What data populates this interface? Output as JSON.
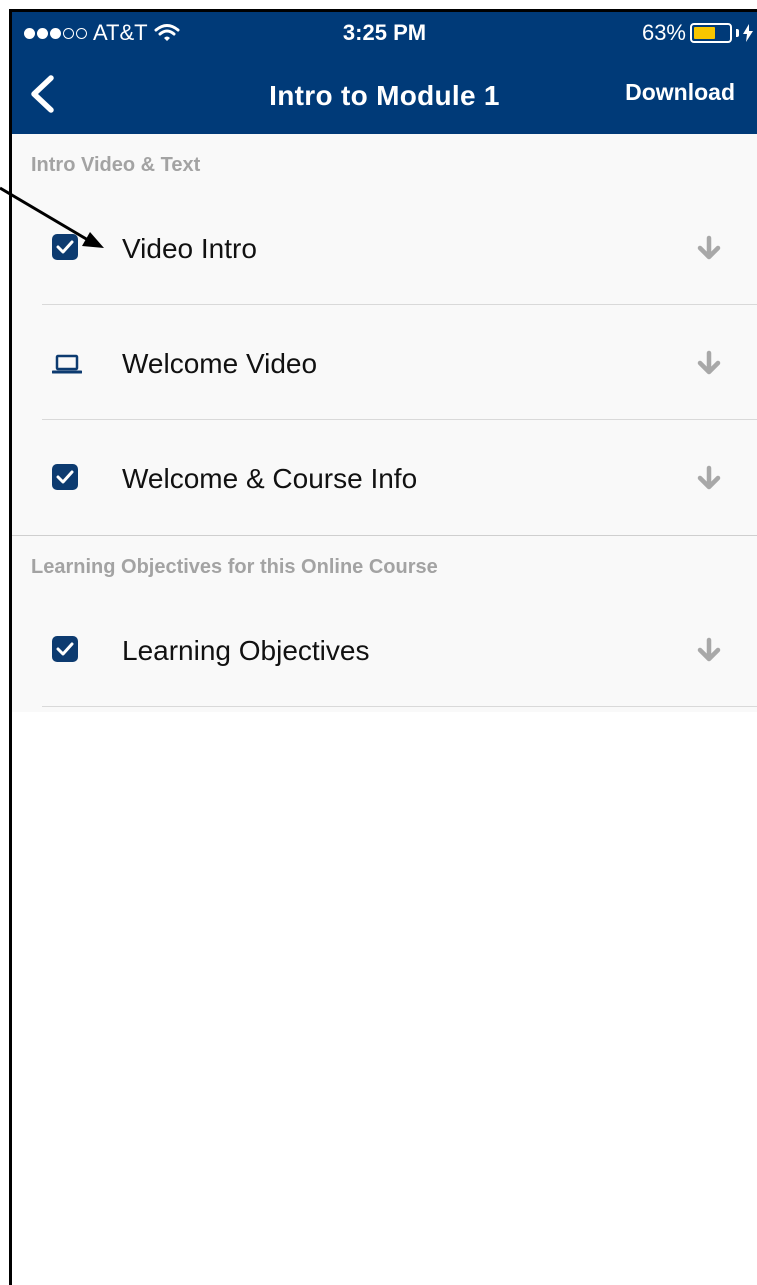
{
  "status_bar": {
    "carrier": "AT&T",
    "time": "3:25 PM",
    "battery": "63%",
    "battery_level": 0.63,
    "signal_bars": 3,
    "signal_total": 5
  },
  "nav": {
    "title": "Intro to Module 1",
    "action_label": "Download",
    "background": "#003a78"
  },
  "sections": [
    {
      "header": "Intro Video & Text",
      "items": [
        {
          "label": "Video Intro",
          "icon": "checkbox-checked-icon"
        },
        {
          "label": "Welcome Video",
          "icon": "laptop-icon"
        },
        {
          "label": "Welcome & Course Info",
          "icon": "checkbox-checked-icon"
        }
      ]
    },
    {
      "header": "Learning Objectives for this Online Course",
      "items": [
        {
          "label": "Learning Objectives",
          "icon": "checkbox-checked-icon"
        }
      ]
    }
  ],
  "colors": {
    "accent": "#0d3b70",
    "battery_fill": "#f7c600",
    "download_arrow": "#a8a8a8"
  }
}
